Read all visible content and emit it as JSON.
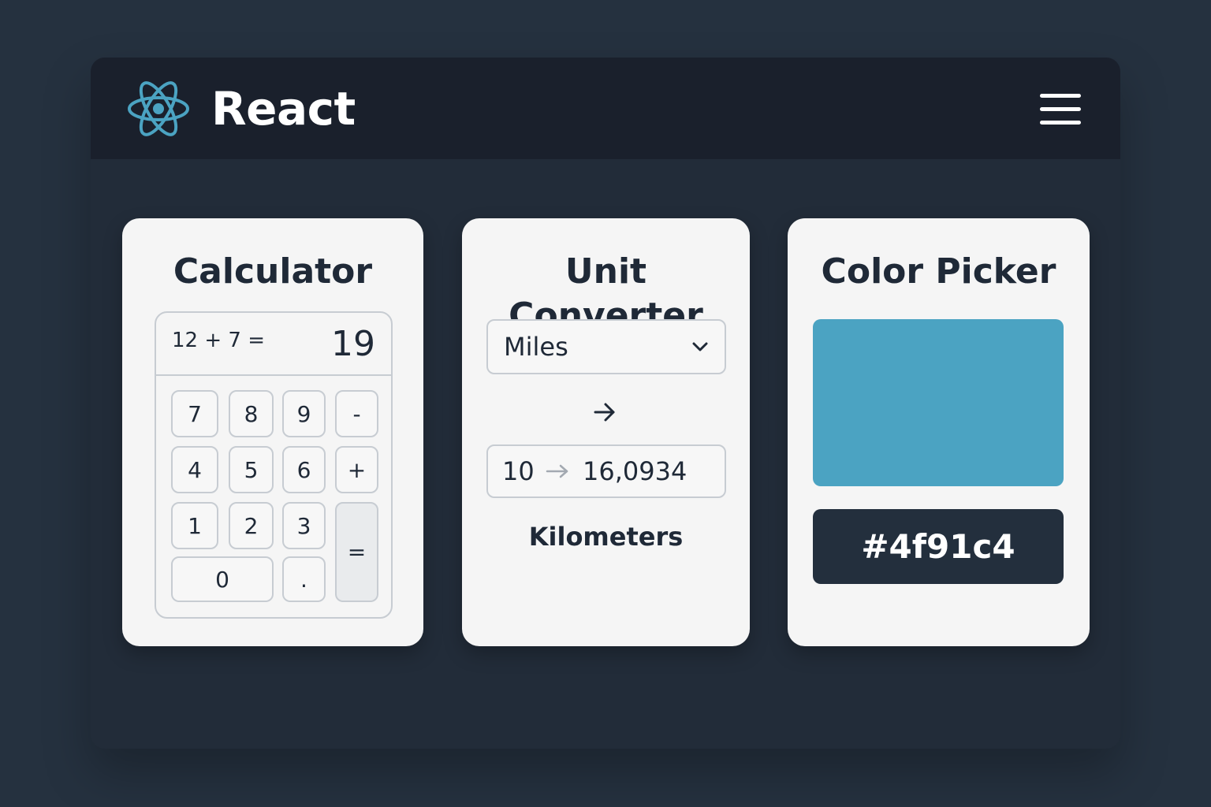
{
  "header": {
    "brand": "React",
    "logo_icon": "react-atom-icon",
    "menu_icon": "hamburger-menu-icon"
  },
  "colors": {
    "react_blue": "#4ba3c2",
    "header_bg": "#1a202c",
    "swatch": "#4ba3c2"
  },
  "calculator": {
    "title": "Calculator",
    "expression": "12 + 7 =",
    "result": "19",
    "keys": {
      "k7": "7",
      "k8": "8",
      "k9": "9",
      "minus": "-",
      "k4": "4",
      "k5": "5",
      "k6": "6",
      "plus": "+",
      "k1": "1",
      "k2": "2",
      "k3": "3",
      "equals": "=",
      "k0": "0",
      "dot": "."
    }
  },
  "converter": {
    "title": "Unit Converter",
    "from_unit": "Miles",
    "input_value": "10",
    "output_value": "16,0934",
    "to_unit": "Kilometers"
  },
  "picker": {
    "title": "Color Picker",
    "hex_value": "#4f91c4"
  }
}
